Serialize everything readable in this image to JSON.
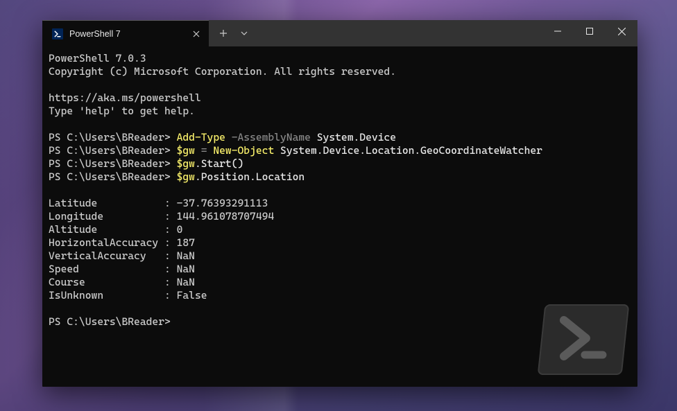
{
  "tab": {
    "title": "PowerShell 7"
  },
  "terminal": {
    "version_line": "PowerShell 7.0.3",
    "copyright_line": "Copyright (c) Microsoft Corporation. All rights reserved.",
    "url_line": "https://aka.ms/powershell",
    "help_line": "Type 'help' to get help.",
    "prompt": "PS C:\\Users\\BReader>",
    "cmd1": {
      "kw1": "Add-Type",
      "param": "-AssemblyName",
      "arg": "System.Device"
    },
    "cmd2": {
      "var": "$gw",
      "eq": "=",
      "kw1": "New-Object",
      "arg": "System.Device.Location.GeoCoordinateWatcher"
    },
    "cmd3": {
      "var": "$gw",
      "rest": ".Start()"
    },
    "cmd4": {
      "var": "$gw",
      "rest": ".Position.Location"
    },
    "output": {
      "Latitude": "-37.76393291113",
      "Longitude": "144.961078707494",
      "Altitude": "0",
      "HorizontalAccuracy": "187",
      "VerticalAccuracy": "NaN",
      "Speed": "NaN",
      "Course": "NaN",
      "IsUnknown": "False"
    }
  }
}
